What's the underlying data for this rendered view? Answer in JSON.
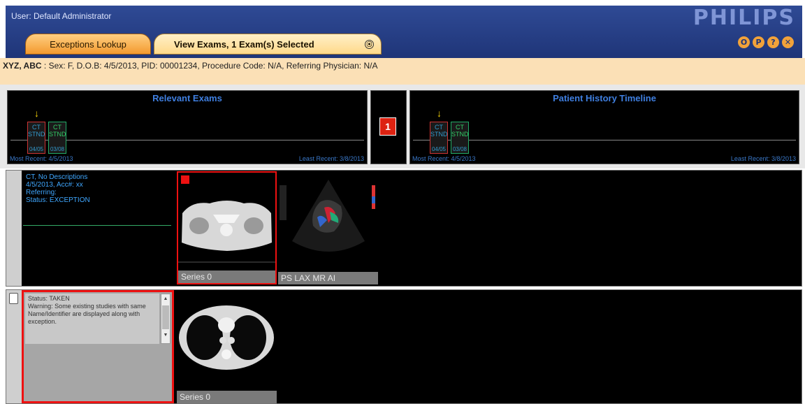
{
  "header": {
    "user": "User: Default Administrator",
    "logo": "PHILIPS",
    "icons": [
      {
        "name": "o-icon",
        "glyph": "O"
      },
      {
        "name": "p-icon",
        "glyph": "P"
      },
      {
        "name": "help-icon",
        "glyph": "?"
      },
      {
        "name": "close-icon",
        "glyph": "✕"
      }
    ]
  },
  "tabs": {
    "exceptions_label": "Exceptions Lookup",
    "view_label": "View Exams, 1 Exam(s) Selected",
    "view_close_glyph": "⦿"
  },
  "patient": {
    "name": "XYZ, ABC",
    "details": " : Sex: F, D.O.B: 4/5/2013, PID: 00001234, Procedure Code: N/A, Referring Physician: N/A"
  },
  "relevant_exams": {
    "title": "Relevant Exams",
    "most_recent": "Most Recent: 4/5/2013",
    "least_recent": "Least Recent: 3/8/2013",
    "exams": [
      {
        "mod": "CT",
        "stnd": "STND",
        "date": "04/05"
      },
      {
        "mod": "CT",
        "stnd": "STND",
        "date": "03/08"
      }
    ]
  },
  "count_badge": "1",
  "history_timeline": {
    "title": "Patient History Timeline",
    "most_recent": "Most Recent: 4/5/2013",
    "least_recent": "Least Recent: 3/8/2013",
    "exams": [
      {
        "mod": "CT",
        "stnd": "STND",
        "date": "04/05"
      },
      {
        "mod": "CT",
        "stnd": "STND",
        "date": "03/08"
      }
    ]
  },
  "exam_row1": {
    "lines": [
      "CT, No Descriptions",
      "4/5/2013, Acc#: xx",
      "Referring:",
      "Status: EXCEPTION"
    ],
    "series": [
      {
        "label": "Series 0"
      },
      {
        "label": "PS LAX MR AI"
      }
    ]
  },
  "exam_row2": {
    "status": "Status: TAKEN",
    "warning": "Warning: Some existing studies with same Name/Identifier are displayed along with exception.",
    "series": [
      {
        "label": "Series 0"
      }
    ]
  },
  "colors": {
    "header_blue": "#1f3578",
    "accent_orange": "#f39a2e",
    "patient_bar": "#fbe0b6",
    "selection_red": "#e11111"
  }
}
